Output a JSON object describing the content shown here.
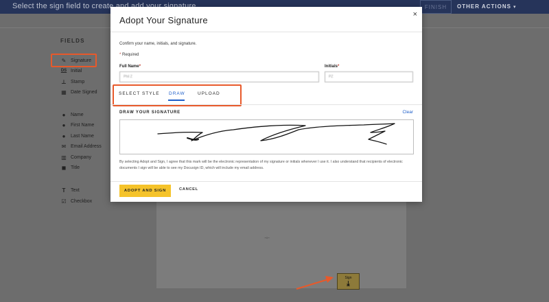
{
  "topbar": {
    "hint": "Select the sign field to create and add your signature",
    "finish_label": "FINISH",
    "other_actions_label": "OTHER ACTIONS",
    "other_actions_caret": "▾"
  },
  "sidebar": {
    "title": "FIELDS",
    "items": [
      {
        "label": "Signature",
        "icon": "pen-icon"
      },
      {
        "label": "Initial",
        "icon": "initials-ds-icon"
      },
      {
        "label": "Stamp",
        "icon": "stamp-icon"
      },
      {
        "label": "Date Signed",
        "icon": "calendar-icon"
      },
      {
        "label": "Name",
        "icon": "person-icon"
      },
      {
        "label": "First Name",
        "icon": "person-icon"
      },
      {
        "label": "Last Name",
        "icon": "person-icon"
      },
      {
        "label": "Email Address",
        "icon": "envelope-icon"
      },
      {
        "label": "Company",
        "icon": "building-icon"
      },
      {
        "label": "Title",
        "icon": "briefcase-icon"
      },
      {
        "label": "Text",
        "icon": "text-t-icon"
      },
      {
        "label": "Checkbox",
        "icon": "checkbox-icon"
      }
    ]
  },
  "document": {
    "sign_tag_label": "Sign"
  },
  "modal": {
    "title": "Adopt Your Signature",
    "confirm_text": "Confirm your name, initials, and signature.",
    "required_text": "Required",
    "full_name_label": "Full Name",
    "full_name_value": "Phil Z",
    "initials_label": "Initials",
    "initials_value": "PZ",
    "tabs": [
      {
        "label": "SELECT STYLE",
        "active": false
      },
      {
        "label": "DRAW",
        "active": true
      },
      {
        "label": "UPLOAD",
        "active": false
      }
    ],
    "draw_title": "DRAW YOUR SIGNATURE",
    "clear_label": "Clear",
    "legal_text": "By selecting Adopt and Sign, I agree that this mark will be the electronic representation of my signature or initials whenever I use it. I also understand that recipients of electronic documents I sign will be able to see my Docusign ID, which will include my email address.",
    "adopt_label": "ADOPT AND SIGN",
    "cancel_label": "CANCEL",
    "close_glyph": "×"
  },
  "colors": {
    "accent_blue": "#1d5ec9",
    "adopt_yellow": "#f5c32a",
    "highlight_orange": "#e8592a",
    "topbar_navy": "#26345a"
  }
}
